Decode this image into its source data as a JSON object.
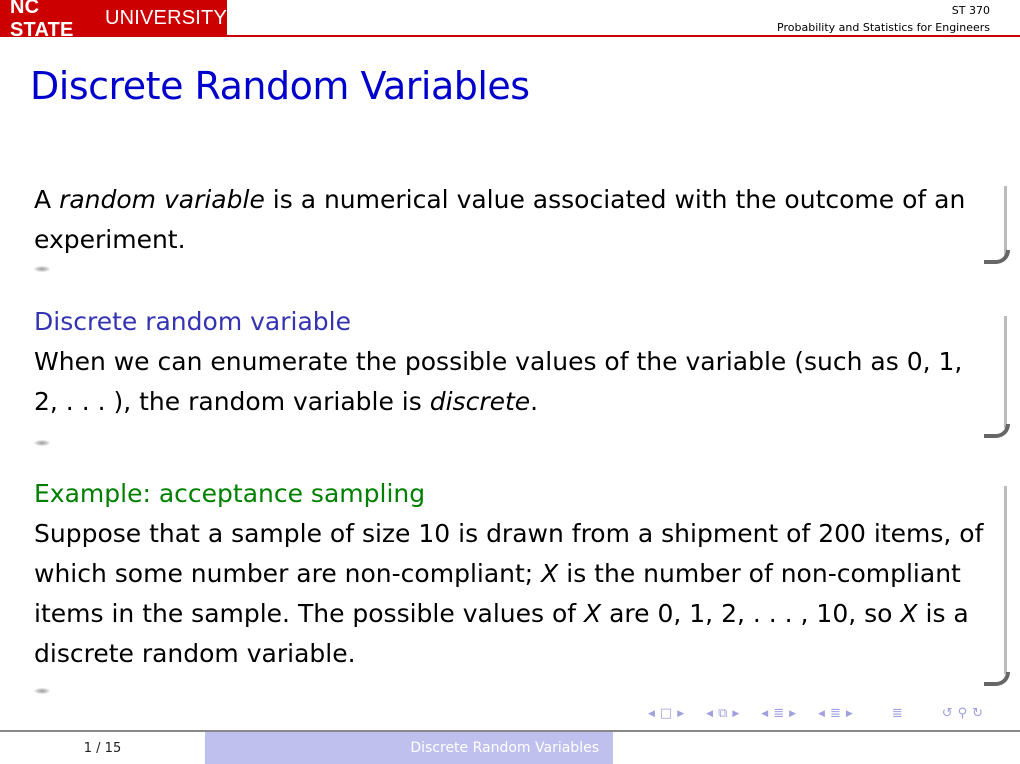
{
  "header": {
    "logo_bold": "NC STATE",
    "logo_thin": "UNIVERSITY",
    "course_code": "ST 370",
    "course_name": "Probability and Statistics for Engineers",
    "accent_color": "#cc0000"
  },
  "slide": {
    "title": "Discrete Random Variables",
    "block1": {
      "pre": "A ",
      "emph": "random variable",
      "post": " is a numerical value associated with the outcome of an experiment."
    },
    "block2": {
      "heading": "Discrete random variable",
      "pre": "When we can enumerate the possible values of the variable (such as 0, 1, 2, . . . ), the random variable is ",
      "emph": "discrete",
      "post": "."
    },
    "block3": {
      "heading": "Example: acceptance sampling",
      "part1": "Suppose that a sample of size 10 is drawn from a shipment of 200 items, of which some number are non-compliant; ",
      "var1": "X",
      "part2": " is the number of non-compliant items in the sample. The possible values of ",
      "var2": "X",
      "part3": " are 0, 1, 2, . . . , 10, so ",
      "var3": "X",
      "part4": " is a discrete random variable."
    }
  },
  "nav": {
    "prev": "◀",
    "frame": "□",
    "next": "▶",
    "subsection": "⧉",
    "section": "≣",
    "doc": "≣",
    "back": "↺",
    "search": "⚲",
    "forward": "↻"
  },
  "footer": {
    "page": "1 / 15",
    "short_title": "Discrete Random Variables"
  }
}
